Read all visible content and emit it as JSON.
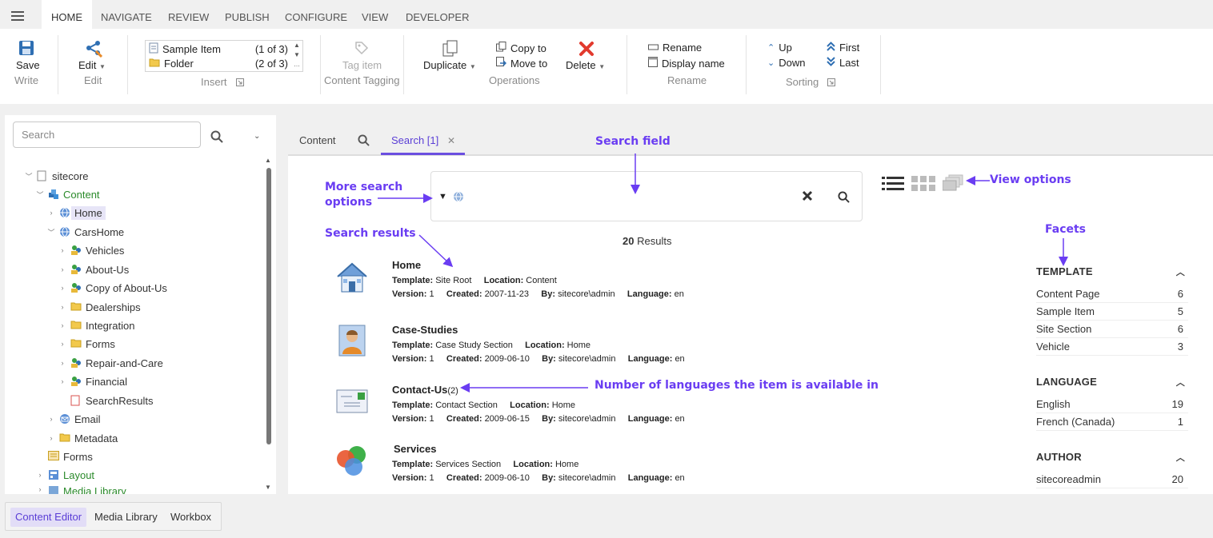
{
  "menubar": {
    "tabs": [
      "HOME",
      "NAVIGATE",
      "REVIEW",
      "PUBLISH",
      "CONFIGURE",
      "VIEW",
      "DEVELOPER"
    ]
  },
  "ribbon": {
    "save": "Save",
    "write_group": "Write",
    "edit": "Edit",
    "edit_group": "Edit",
    "insert_items": [
      {
        "label": "Sample Item",
        "count": "(1 of 3)"
      },
      {
        "label": "Folder",
        "count": "(2 of 3)"
      }
    ],
    "insert_group": "Insert",
    "tag_item": "Tag item",
    "tagging_group": "Content Tagging",
    "duplicate": "Duplicate",
    "copy_to": "Copy to",
    "move_to": "Move to",
    "delete": "Delete",
    "operations_group": "Operations",
    "rename": "Rename",
    "display_name": "Display name",
    "rename_group": "Rename",
    "up": "Up",
    "down": "Down",
    "first": "First",
    "last": "Last",
    "sorting_group": "Sorting"
  },
  "tree": {
    "search_placeholder": "Search",
    "items": [
      {
        "label": "sitecore"
      },
      {
        "label": "Content"
      },
      {
        "label": "Home"
      },
      {
        "label": "CarsHome"
      },
      {
        "label": "Vehicles"
      },
      {
        "label": "About-Us"
      },
      {
        "label": "Copy of About-Us"
      },
      {
        "label": "Dealerships"
      },
      {
        "label": "Integration"
      },
      {
        "label": "Forms"
      },
      {
        "label": "Repair-and-Care"
      },
      {
        "label": "Financial"
      },
      {
        "label": "SearchResults"
      },
      {
        "label": "Email"
      },
      {
        "label": "Metadata"
      },
      {
        "label": "Forms"
      },
      {
        "label": "Layout"
      },
      {
        "label": "Media Library"
      }
    ]
  },
  "content_tabs": {
    "content": "Content",
    "search": "Search [1]"
  },
  "search": {
    "results_count": "20",
    "results_label": "Results"
  },
  "results": [
    {
      "title": "Home",
      "lang_count": "",
      "template": "Site Root",
      "location": "Content",
      "version": "1",
      "created": "2007-11-23",
      "by": "sitecore\\admin",
      "language": "en"
    },
    {
      "title": "Case-Studies",
      "lang_count": "",
      "template": "Case Study Section",
      "location": "Home",
      "version": "1",
      "created": "2009-06-10",
      "by": "sitecore\\admin",
      "language": "en"
    },
    {
      "title": "Contact-Us",
      "lang_count": "(2)",
      "template": "Contact Section",
      "location": "Home",
      "version": "1",
      "created": "2009-06-15",
      "by": "sitecore\\admin",
      "language": "en"
    },
    {
      "title": "Services",
      "lang_count": "",
      "template": "Services Section",
      "location": "Home",
      "version": "1",
      "created": "2009-06-10",
      "by": "sitecore\\admin",
      "language": "en"
    }
  ],
  "meta_labels": {
    "template": "Template:",
    "location": "Location:",
    "version": "Version:",
    "created": "Created:",
    "by": "By:",
    "language": "Language:"
  },
  "facets": {
    "template": {
      "heading": "TEMPLATE",
      "rows": [
        {
          "label": "Content Page",
          "value": "6"
        },
        {
          "label": "Sample Item",
          "value": "5"
        },
        {
          "label": "Site Section",
          "value": "6"
        },
        {
          "label": "Vehicle",
          "value": "3"
        }
      ]
    },
    "language": {
      "heading": "LANGUAGE",
      "rows": [
        {
          "label": "English",
          "value": "19"
        },
        {
          "label": "French (Canada)",
          "value": "1"
        }
      ]
    },
    "author": {
      "heading": "AUTHOR",
      "rows": [
        {
          "label": "sitecoreadmin",
          "value": "20"
        }
      ]
    }
  },
  "annotations": {
    "search_field": "Search field",
    "more_options_1": "More search",
    "more_options_2": "options",
    "view_options": "View options",
    "search_results": "Search results",
    "facets": "Facets",
    "languages": "Number of languages the item is available in"
  },
  "bottom_tabs": [
    "Content Editor",
    "Media Library",
    "Workbox"
  ],
  "colors": {
    "accent": "#6b4fe0",
    "annotation": "#6a3df2",
    "tree_green": "#2a8a2a"
  }
}
